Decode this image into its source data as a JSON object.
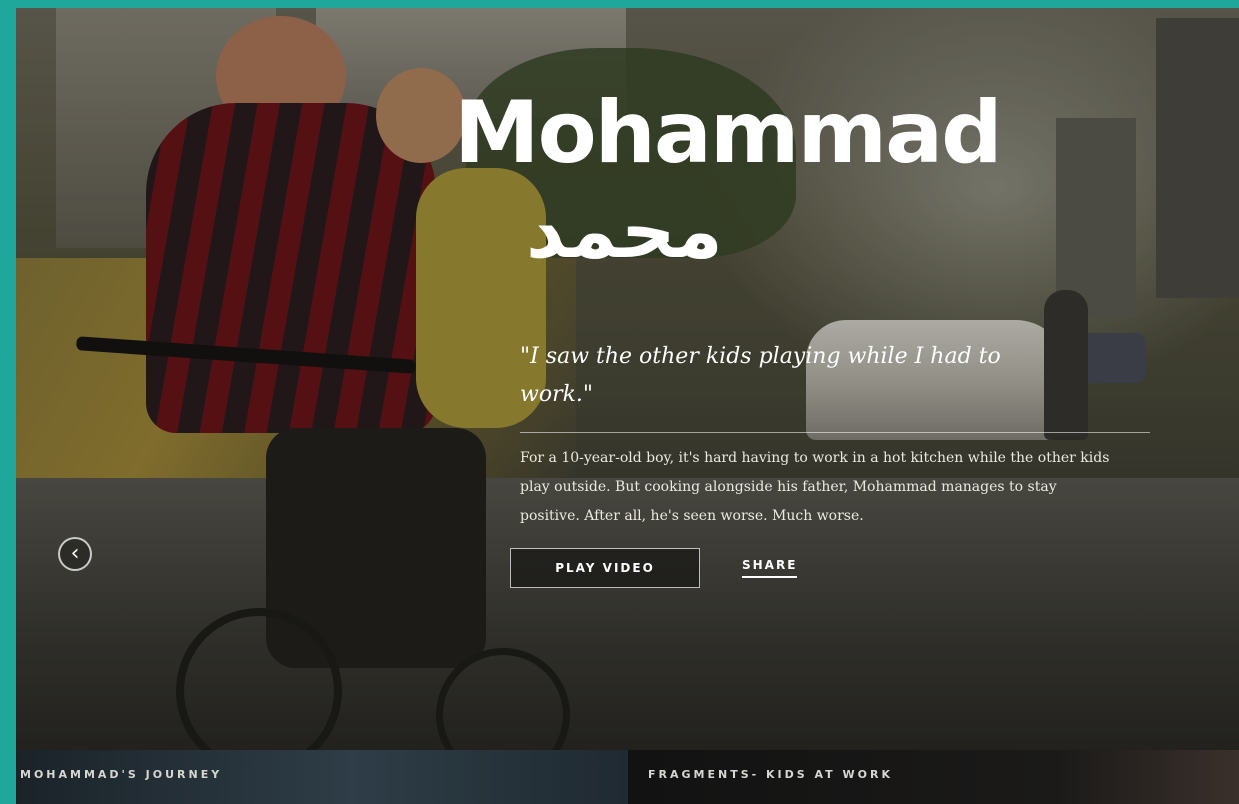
{
  "hero": {
    "title_en": "Mohammad",
    "title_ar": "محمد",
    "quote": "\"I saw the other kids playing while I had to work.\"",
    "description": "For a 10-year-old boy, it's hard having to work in a hot kitchen while the other kids play outside. But cooking alongside his father, Mohammad manages to stay positive. After all, he's seen worse. Much worse.",
    "play_label": "PLAY VIDEO",
    "share_label": "SHARE",
    "prev_icon": "‹"
  },
  "tabs": [
    {
      "label": "MOHAMMAD'S JOURNEY"
    },
    {
      "label": "FRAGMENTS- KIDS AT WORK"
    }
  ],
  "colors": {
    "border": "#1fa79b",
    "text": "#ffffff"
  }
}
